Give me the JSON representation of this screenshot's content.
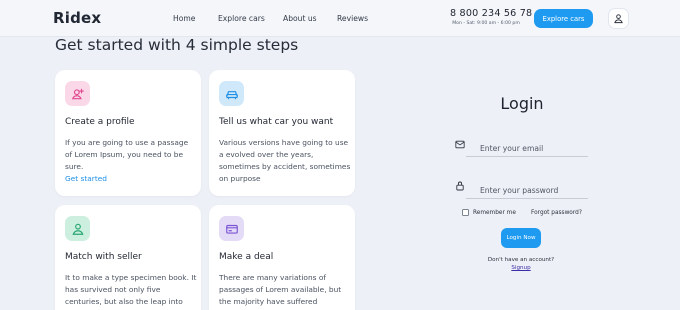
{
  "header": {
    "logo": "Ridex",
    "nav": [
      "Home",
      "Explore cars",
      "About us",
      "Reviews"
    ],
    "phone": "8 800 234 56 78",
    "hours": "Mon - Sat: 9:00 am - 6:00 pm",
    "cta_label": "Explore cars",
    "user_icon": "user-icon"
  },
  "steps": {
    "title": "Get started with 4 simple steps",
    "cards": [
      {
        "icon": "person-add-icon",
        "icon_bg": "#fbd8e8",
        "icon_color": "#e0488f",
        "title": "Create a profile",
        "desc": "If you are going to use a passage of Lorem Ipsum, you need to be sure.",
        "link": "Get started"
      },
      {
        "icon": "car-icon",
        "icon_bg": "#cfe9fb",
        "icon_color": "#1e8fe6",
        "title": "Tell us what car you want",
        "desc": "Various versions have going to use a evolved over the years, sometimes by accident, sometimes on purpose"
      },
      {
        "icon": "person-icon",
        "icon_bg": "#ccefe0",
        "icon_color": "#2aa873",
        "title": "Match with seller",
        "desc": "It to make a type specimen book. It has survived not only five centuries, but also the leap into"
      },
      {
        "icon": "credit-card-icon",
        "icon_bg": "#e4dcf7",
        "icon_color": "#7b55d6",
        "title": "Make a deal",
        "desc": "There are many variations of passages of Lorem available, but the majority have suffered"
      }
    ]
  },
  "login": {
    "title": "Login",
    "email_placeholder": "Enter your email",
    "password_placeholder": "Enter your password",
    "remember_label": "Remember me",
    "forgot_label": "Forgot password?",
    "button_label": "Login Now",
    "no_account_text": "Don't have an account?",
    "signup_label": "Signup"
  },
  "colors": {
    "accent": "#1e9bf0",
    "background": "#edf0f6",
    "card": "#ffffff"
  }
}
